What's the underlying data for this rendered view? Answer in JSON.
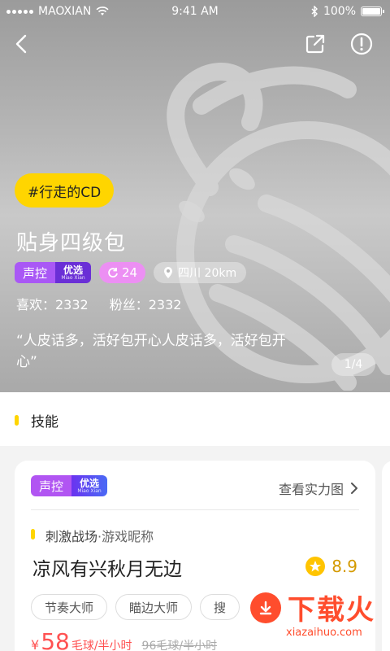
{
  "status_bar": {
    "carrier": "MAOXIAN",
    "time": "9:41 AM",
    "battery": "100%"
  },
  "header": {
    "back_icon": "back-arrow-icon",
    "share_icon": "share-icon",
    "report_icon": "alert-icon"
  },
  "profile": {
    "topic_tag": "#行走的CD",
    "name": "贴身四级包",
    "voice_badge": {
      "label": "声控",
      "badge_main": "优选",
      "badge_sub": "Miao Xian"
    },
    "count_badge": "24",
    "location": "四川  20km",
    "likes_label": "喜欢：2332",
    "fans_label": "粉丝：2332",
    "quote": "“人皮话多，活好包开心人皮话多，活好包开心”",
    "pager": "1/4"
  },
  "section": {
    "title": "技能"
  },
  "skill_card": {
    "voice_badge": {
      "label": "声控",
      "badge_main": "优选",
      "badge_sub": "Miao Xian"
    },
    "strength_link": "查看实力图",
    "skill_name": "刺激战场",
    "skill_type": "·游戏昵称",
    "nickname": "凉风有兴秋月无边",
    "rating": "8.9",
    "tags": [
      "节奏大师",
      "瞄边大师",
      "搜"
    ],
    "price_currency": "¥",
    "price_amount": "58",
    "price_unit": "毛球/半小时",
    "price_old": "96毛球/半小时"
  },
  "watermark": {
    "text": "下载火",
    "url": "xiazaihuo.com"
  },
  "colors": {
    "accent_yellow": "#ffd500",
    "voice_purple": "#a958f5",
    "pink": "#ec8ff3",
    "price_red": "#ff5252"
  }
}
